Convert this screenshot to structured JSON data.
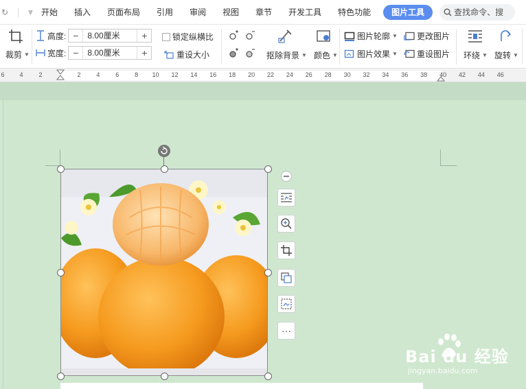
{
  "menu": {
    "tabs": [
      "开始",
      "插入",
      "页面布局",
      "引用",
      "审阅",
      "视图",
      "章节",
      "开发工具",
      "特色功能"
    ],
    "active_tab": "图片工具",
    "search_text": "查找命令、搜"
  },
  "ribbon": {
    "crop_label": "裁剪",
    "height_label": "高度:",
    "height_value": "8.00厘米",
    "width_label": "宽度:",
    "width_value": "8.00厘米",
    "lock_ratio_label": "锁定纵横比",
    "reset_size_label": "重设大小",
    "remove_bg_label": "抠除背景",
    "color_label": "颜色",
    "outline_label": "图片轮廓",
    "effects_label": "图片效果",
    "change_picture_label": "更改图片",
    "reset_picture_label": "重设图片",
    "wrap_label": "环绕",
    "rotate_label": "旋转"
  },
  "ruler": {
    "left_ticks": [
      "6",
      "4",
      "2"
    ],
    "ticks": [
      "2",
      "4",
      "6",
      "8",
      "10",
      "12",
      "14",
      "16",
      "18",
      "20",
      "22",
      "24",
      "26",
      "28",
      "30",
      "32",
      "34",
      "36",
      "38",
      "40",
      "42",
      "44",
      "46"
    ]
  },
  "picture": {
    "subject": "oranges-photo"
  },
  "side_toolbar": [
    "collapse-icon",
    "layout-options-icon",
    "zoom-icon",
    "crop-icon",
    "change-picture-icon",
    "image-to-text-icon",
    "more-icon"
  ],
  "more_label": "···",
  "watermark": {
    "brand": "Bai du 经验",
    "url": "jingyan.baidu.com"
  }
}
